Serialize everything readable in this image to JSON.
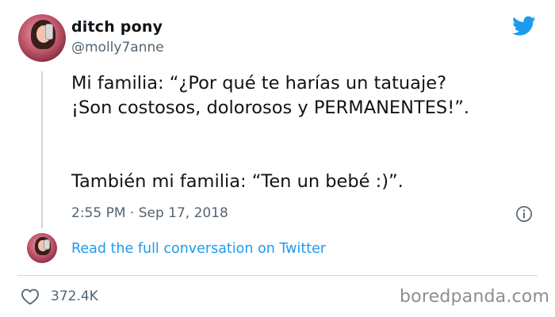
{
  "author": {
    "display_name": "ditch pony",
    "handle": "@molly7anne"
  },
  "tweet": {
    "lines": [
      "Mi familia: “¿Por qué te harías un tatuaje?",
      "¡Son costosos, dolorosos y PERMANENTES!”.",
      "También mi familia: “Ten un bebé :)”."
    ],
    "timestamp": "2:55 PM · Sep 17, 2018"
  },
  "conversation_link": "Read the full conversation on Twitter",
  "likes": "372.4K",
  "watermark": "boredpanda.com",
  "icons": {
    "brand": "twitter-bird-icon",
    "info": "info-icon",
    "like": "heart-icon"
  },
  "colors": {
    "link": "#1d9bf0",
    "brand": "#1d9bf0",
    "muted": "#536471"
  }
}
